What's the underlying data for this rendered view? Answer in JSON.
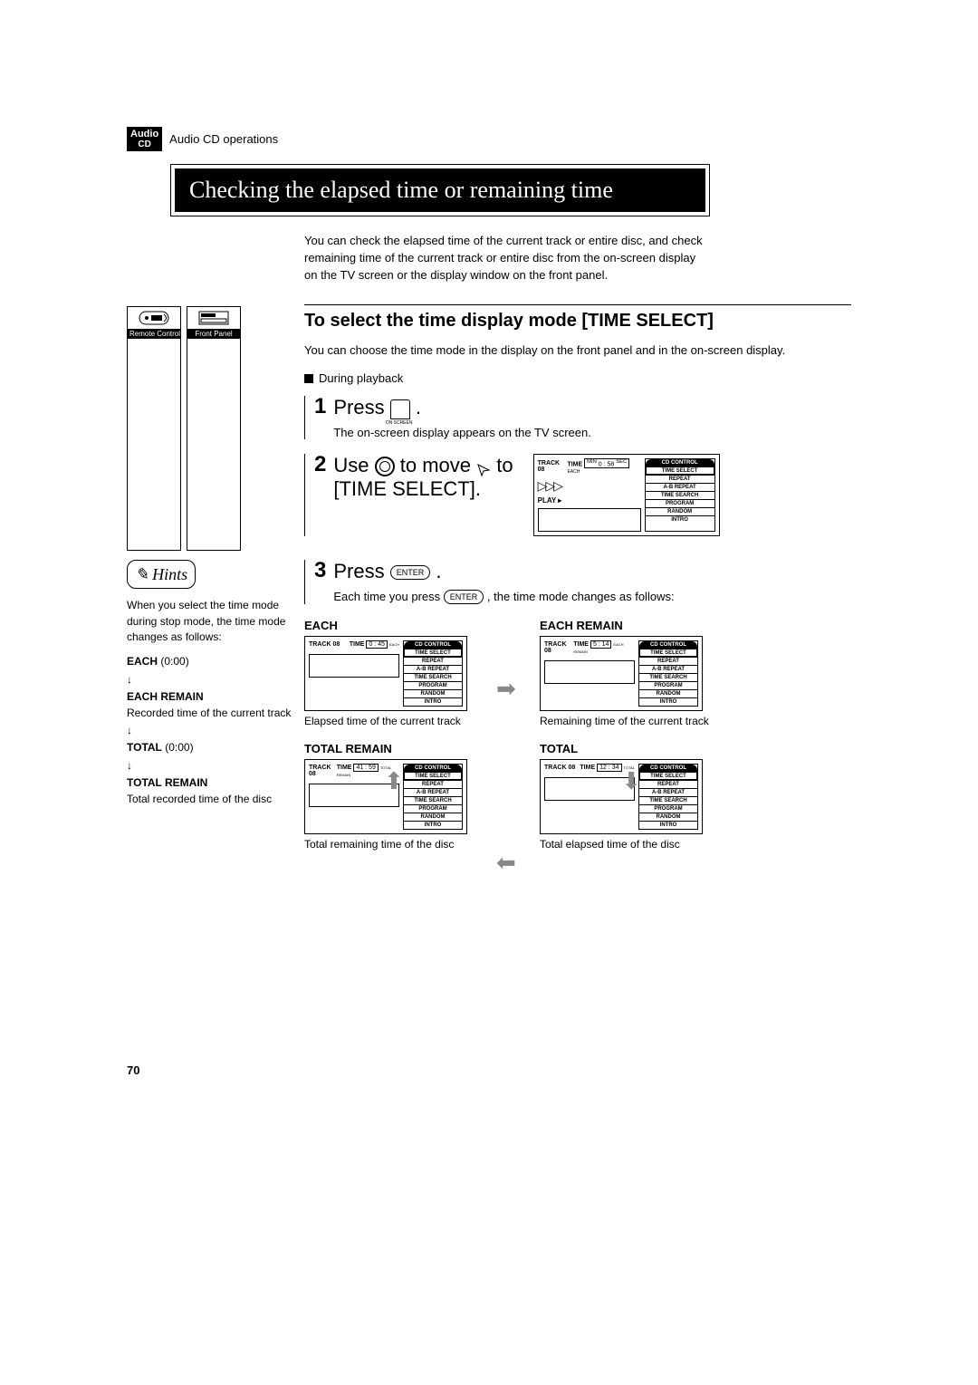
{
  "crumb_badge_top": "Audio",
  "crumb_badge_bot": "CD",
  "crumb_text": "Audio CD operations",
  "title": "Checking the elapsed time or remaining time",
  "intro": "You can check the elapsed time of the current track or entire disc, and check remaining time of the current track or entire disc from the on-screen display on the TV screen or the display window on the front panel.",
  "remote_label": "Remote Control",
  "front_label": "Front Panel",
  "section_title": "To select the time display mode [TIME SELECT]",
  "section_body": "You can choose the time mode in the display on the front panel and in the on-screen display.",
  "condition": "During playback",
  "step1_prefix": "Press",
  "step1_suffix": ".",
  "step1_body": "The on-screen display appears on the TV screen.",
  "step2_pre": "Use",
  "step2_mid": "to move",
  "step2_end": "to",
  "step2_target": "[TIME SELECT].",
  "step3_prefix": "Press",
  "step3_suffix": ".",
  "enter_label": "ENTER",
  "step3_body_a": "Each time you press",
  "step3_body_b": ", the time mode changes as follows:",
  "osd": {
    "track_label": "TRACK 08",
    "time_label": "TIME",
    "min_label": "MIN",
    "sec_label": "SEC",
    "play_label": "PLAY ▸",
    "menu_title": "CD CONTROL",
    "items": [
      "TIME SELECT",
      "REPEAT",
      "A-B REPEAT",
      "TIME SEARCH",
      "PROGRAM",
      "RANDOM",
      "INTRO"
    ]
  },
  "hints_label": "Hints",
  "hints_intro": "When you select the time mode during stop mode, the time mode changes as follows:",
  "hints_seq": [
    {
      "label": "EACH",
      "value": "(0:00)"
    },
    {
      "label": "EACH REMAIN",
      "value": ""
    },
    {
      "label_desc": "Recorded time of the current track"
    },
    {
      "label": "TOTAL",
      "value": "(0:00)"
    },
    {
      "label": "TOTAL REMAIN",
      "value": ""
    },
    {
      "label_desc": "Total recorded time of the disc"
    }
  ],
  "modes": {
    "each": {
      "title": "EACH",
      "time": "0 : 45",
      "tag": "EACH",
      "caption": "Elapsed time of the current track"
    },
    "each_remain": {
      "title": "EACH REMAIN",
      "time": "5 : 14",
      "tag": "EACH REMAIN",
      "caption": "Remaining time of the current track"
    },
    "total_remain": {
      "title": "TOTAL REMAIN",
      "time": "41 : 59",
      "tag": "TOTAL REMAIN",
      "caption": "Total remaining time of the disc"
    },
    "total": {
      "title": "TOTAL",
      "time": "12 : 34",
      "tag": "TOTAL",
      "caption": "Total elapsed time of the disc"
    }
  },
  "page_number": "70"
}
